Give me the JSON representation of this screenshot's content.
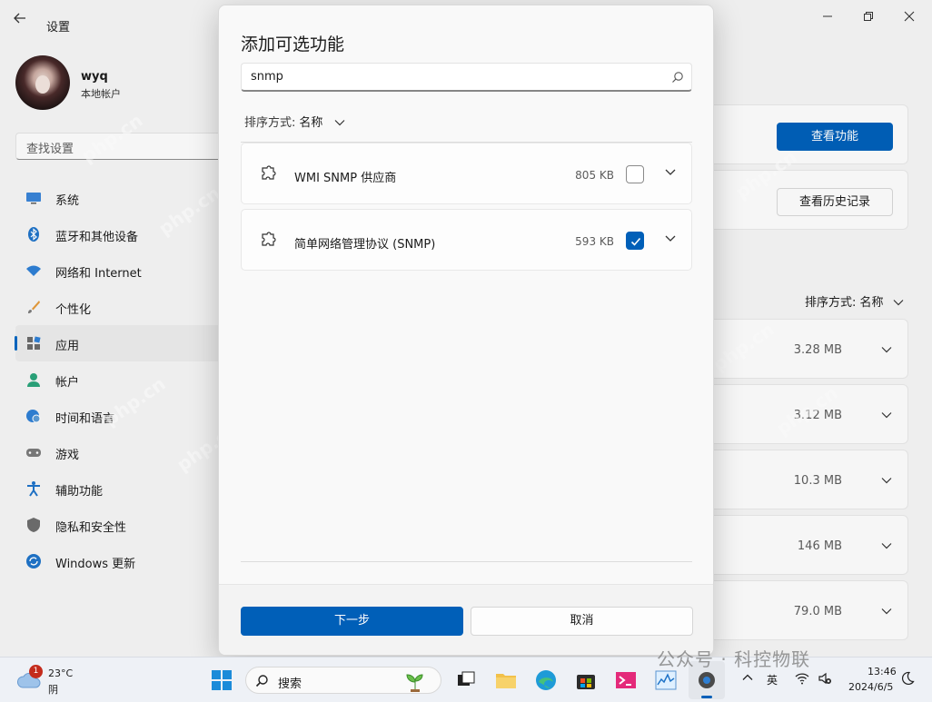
{
  "settings": {
    "title": "设置",
    "user": {
      "name": "wyq",
      "account_type": "本地帐户"
    },
    "search_placeholder": "查找设置",
    "nav": [
      {
        "label": "系统",
        "icon": "monitor-icon"
      },
      {
        "label": "蓝牙和其他设备",
        "icon": "bluetooth-icon"
      },
      {
        "label": "网络和 Internet",
        "icon": "wifi-icon"
      },
      {
        "label": "个性化",
        "icon": "brush-icon"
      },
      {
        "label": "应用",
        "icon": "apps-icon",
        "active": true
      },
      {
        "label": "帐户",
        "icon": "person-icon"
      },
      {
        "label": "时间和语言",
        "icon": "globe-clock-icon"
      },
      {
        "label": "游戏",
        "icon": "gamepad-icon"
      },
      {
        "label": "辅助功能",
        "icon": "accessibility-icon"
      },
      {
        "label": "隐私和安全性",
        "icon": "shield-icon"
      },
      {
        "label": "Windows 更新",
        "icon": "update-icon"
      }
    ],
    "right_pane": {
      "view_features_button": "查看功能",
      "view_history_button": "查看历史记录",
      "sort_label": "排序方式:",
      "sort_value": "名称",
      "installed_sizes": [
        "3.28 MB",
        "3.12 MB",
        "10.3 MB",
        "146 MB",
        "79.0 MB"
      ]
    }
  },
  "dialog": {
    "title": "添加可选功能",
    "search_value": "snmp",
    "sort_label": "排序方式:",
    "sort_value": "名称",
    "features": [
      {
        "name": "WMI SNMP 供应商",
        "size": "805 KB",
        "checked": false
      },
      {
        "name": "简单网络管理协议 (SNMP)",
        "size": "593 KB",
        "checked": true
      }
    ],
    "next_button": "下一步",
    "cancel_button": "取消"
  },
  "taskbar": {
    "weather": {
      "temp": "23°C",
      "condition": "阴",
      "badge": "1"
    },
    "search_label": "搜索",
    "ime_label": "英",
    "clock": {
      "time": "13:46",
      "date": "2024/6/5"
    },
    "overlay_watermark": "公众号 · 科控物联"
  },
  "watermark_text": "php.cn",
  "colors": {
    "accent": "#005fb8",
    "window_bg": "#f3f3f3",
    "dialog_bg": "#f9f9f9"
  }
}
